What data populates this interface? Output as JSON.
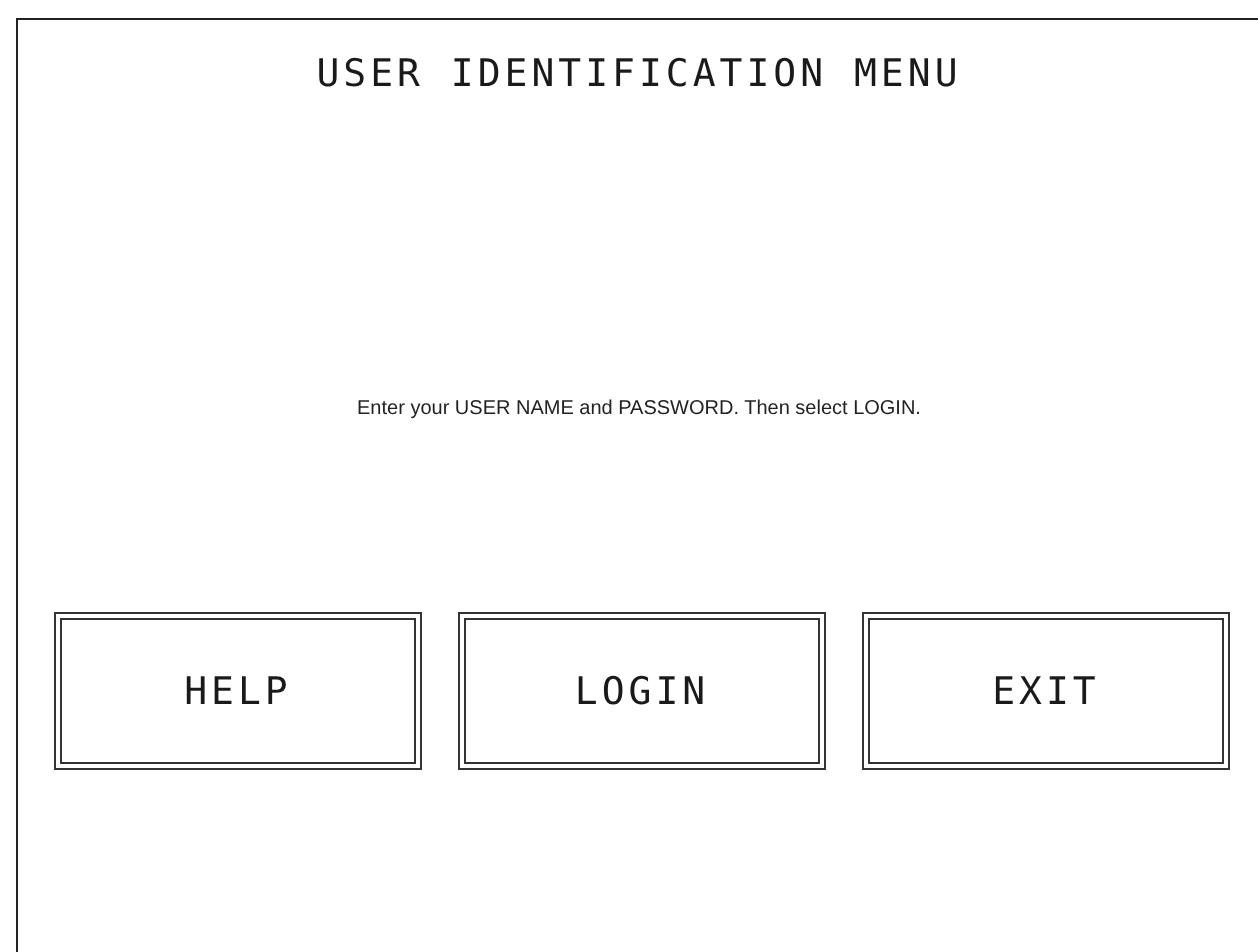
{
  "title": "USER IDENTIFICATION MENU",
  "message": "Enter your USER NAME and PASSWORD. Then select LOGIN.",
  "buttons": [
    "HELP",
    "LOGIN",
    "EXIT"
  ]
}
